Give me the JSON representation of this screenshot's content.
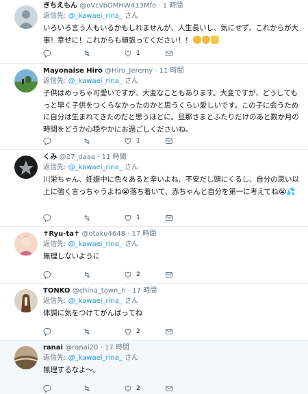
{
  "reply_prefix": "返信先:",
  "reply_suffix": "さん",
  "tweets": [
    {
      "name": "きちえもん",
      "handle": "@oVcvbOMHW413Mfo",
      "time": "1 時間",
      "reply_to": "@_kawaei_rina_",
      "text": "いろいろ言う人もいるかもしれませんが、人生長いし、気にせず、これからが大事！幸せに！これからも頑張ってください！！",
      "emoji": [
        "smile-emoji",
        "smile-emoji",
        "thumbs-up-emoji"
      ],
      "reply_count": "",
      "retweet_count": "",
      "like_count": "1"
    },
    {
      "name": "Mayonaise Hiro",
      "handle": "@Hiro_Jeremy",
      "time": "11 時間",
      "reply_to": "@_kawaei_rina_",
      "text": "子供はめっちゃ可愛いですが、大変なこともあります。大変ですが、どうしてもっと早く子供をつくらなかったのかと思うくらい愛しいです。この子に会うために自分は生まれてきたのだと思うほどに。旦那さまとふたりだけのあと数か月の時間をどうか心穏やかにお過ごしくださいね。",
      "emoji": [],
      "reply_count": "",
      "retweet_count": "",
      "like_count": "1"
    },
    {
      "name": "くみ",
      "handle": "@27_daaa",
      "time": "11 時間",
      "reply_to": "@_kawaei_rina_",
      "text": "川栄ちゃん、妊娠中に色々あると辛いよね、不安だし頭にくるし、自分の思い以上に強く言っちゃうよね😭落ち着いて、赤ちゃんと自分を第一に考えてね😭💦",
      "emoji": [],
      "reply_count": "",
      "retweet_count": "",
      "like_count": "1"
    },
    {
      "name": "✝Ryu-ta✝",
      "handle": "@otaku4648",
      "time": "17 時間",
      "reply_to": "@_kawaei_rina_",
      "text": "無理しないように",
      "emoji": [],
      "reply_count": "",
      "retweet_count": "",
      "like_count": "2"
    },
    {
      "name": "TONKO",
      "handle": "@china_town_h",
      "time": "17 時間",
      "reply_to": "@_kawaei_rina_",
      "text": "体調に気をつけてがんばってね",
      "emoji": [],
      "reply_count": "",
      "retweet_count": "",
      "like_count": "2"
    },
    {
      "name": "ranai",
      "handle": "@ranai20",
      "time": "17 時間",
      "reply_to": "@_kawaei_rina_",
      "text": "無理するなよ〜。",
      "emoji": [],
      "reply_count": "",
      "retweet_count": "",
      "like_count": "2"
    }
  ],
  "colors": {
    "link": "#1b95e0",
    "secondary": "#657786",
    "primary_text": "#14171a",
    "divider": "#e6ecf0"
  }
}
